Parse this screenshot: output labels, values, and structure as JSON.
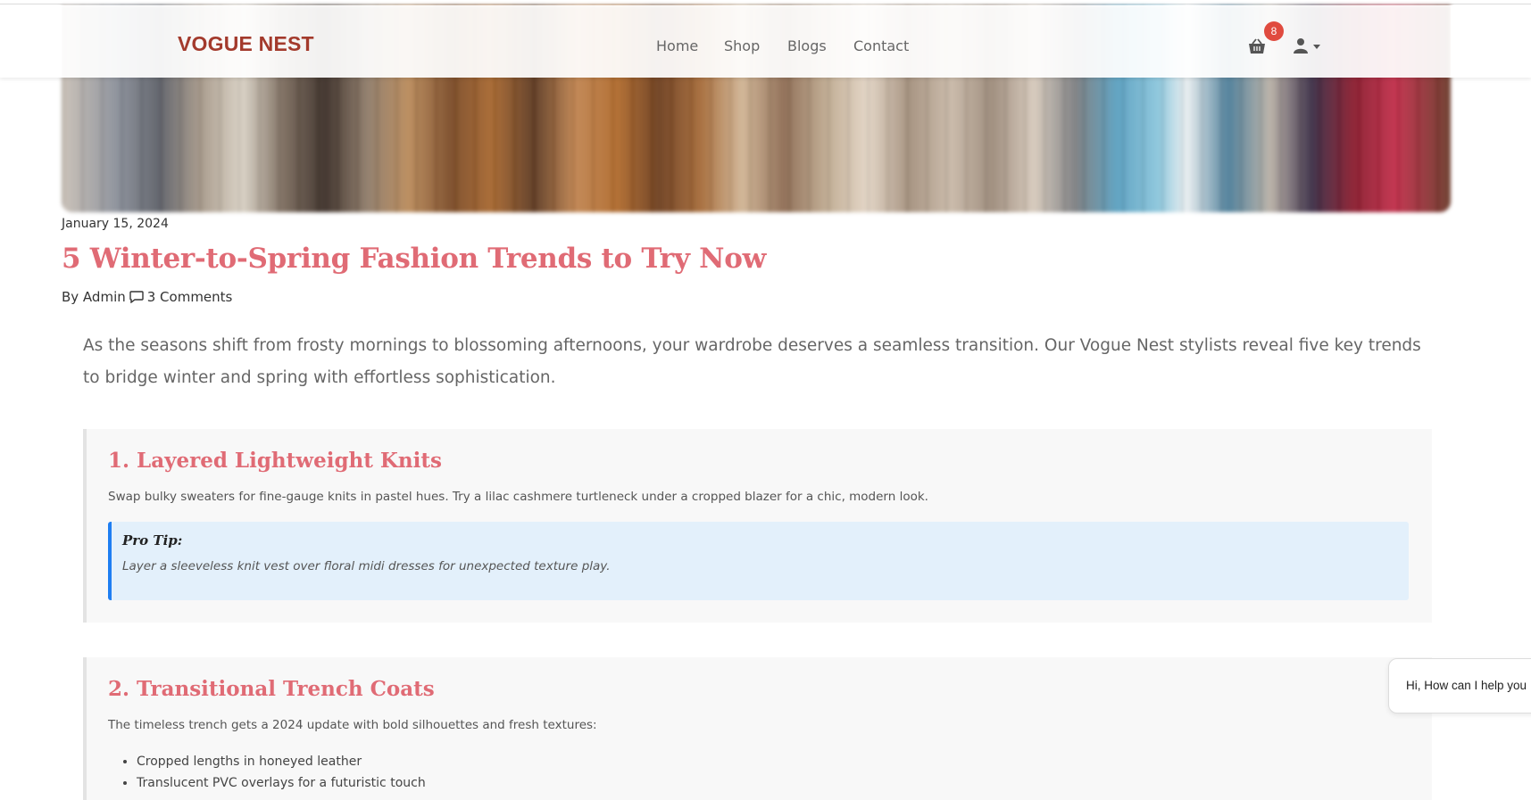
{
  "navbar": {
    "brand": "VOGUE NEST",
    "links": [
      {
        "label": "Home"
      },
      {
        "label": "Shop"
      },
      {
        "label": "Blogs"
      },
      {
        "label": "Contact"
      }
    ],
    "cart_count": "8",
    "icons": {
      "cart": "basket-icon",
      "user": "user-icon",
      "dropdown": "caret-down-icon"
    }
  },
  "post": {
    "date": "January 15, 2024",
    "title": "5 Winter-to-Spring Fashion Trends to Try Now",
    "author": "By Admin",
    "comments": "3 Comments",
    "intro": "As the seasons shift from frosty mornings to blossoming afternoons, your wardrobe deserves a seamless transition. Our Vogue Nest stylists reveal five key trends to bridge winter and spring with effortless sophistication."
  },
  "sections": [
    {
      "title": "1. Layered Lightweight Knits",
      "text": "Swap bulky sweaters for fine-gauge knits in pastel hues. Try a lilac cashmere turtleneck under a cropped blazer for a chic, modern look.",
      "tip_title": "Pro Tip:",
      "tip_text": "Layer a sleeveless knit vest over floral midi dresses for unexpected texture play."
    },
    {
      "title": "2. Transitional Trench Coats",
      "text": "The timeless trench gets a 2024 update with bold silhouettes and fresh textures:",
      "list": [
        "Cropped lengths in honeyed leather",
        "Translucent PVC overlays for a futuristic touch"
      ]
    }
  ],
  "chat": {
    "text": "Hi, How can I help you"
  },
  "colors": {
    "brand": "#a33a2c",
    "accent": "#e06b75",
    "badge": "#e04b3f",
    "tip_border": "#1e7ef2",
    "tip_bg": "#e3f0fb"
  }
}
